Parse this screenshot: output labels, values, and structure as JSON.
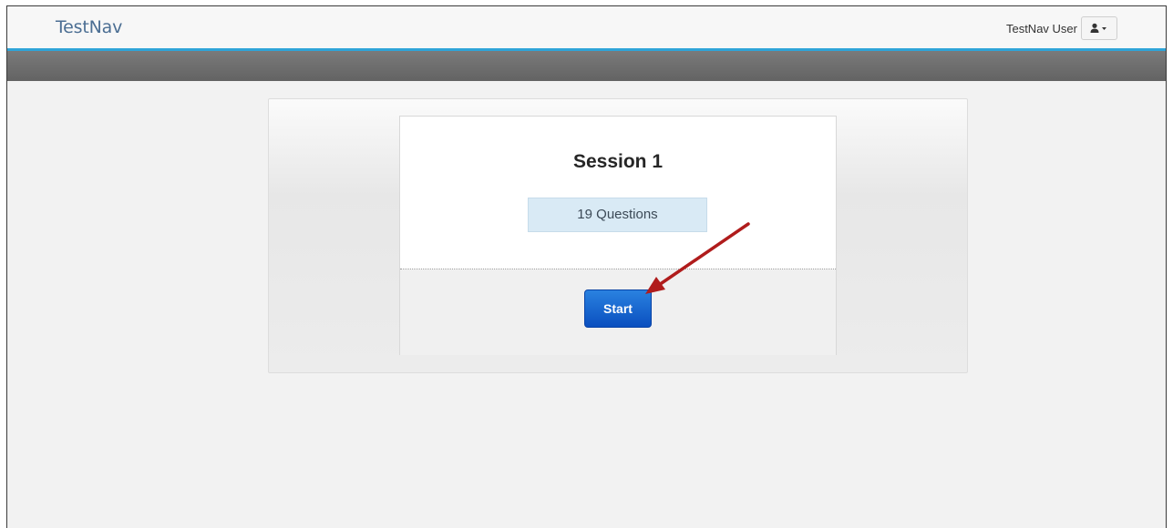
{
  "header": {
    "logo": "TestNav",
    "user_name": "TestNav User",
    "user_icon": "user-icon",
    "dropdown_icon": "caret-down-icon"
  },
  "session": {
    "title": "Session 1",
    "question_count": "19 Questions",
    "start_label": "Start"
  },
  "colors": {
    "accent_line": "#2fa4d8",
    "start_button": "#0a5fd0",
    "annotation_arrow": "#b01c1c"
  }
}
